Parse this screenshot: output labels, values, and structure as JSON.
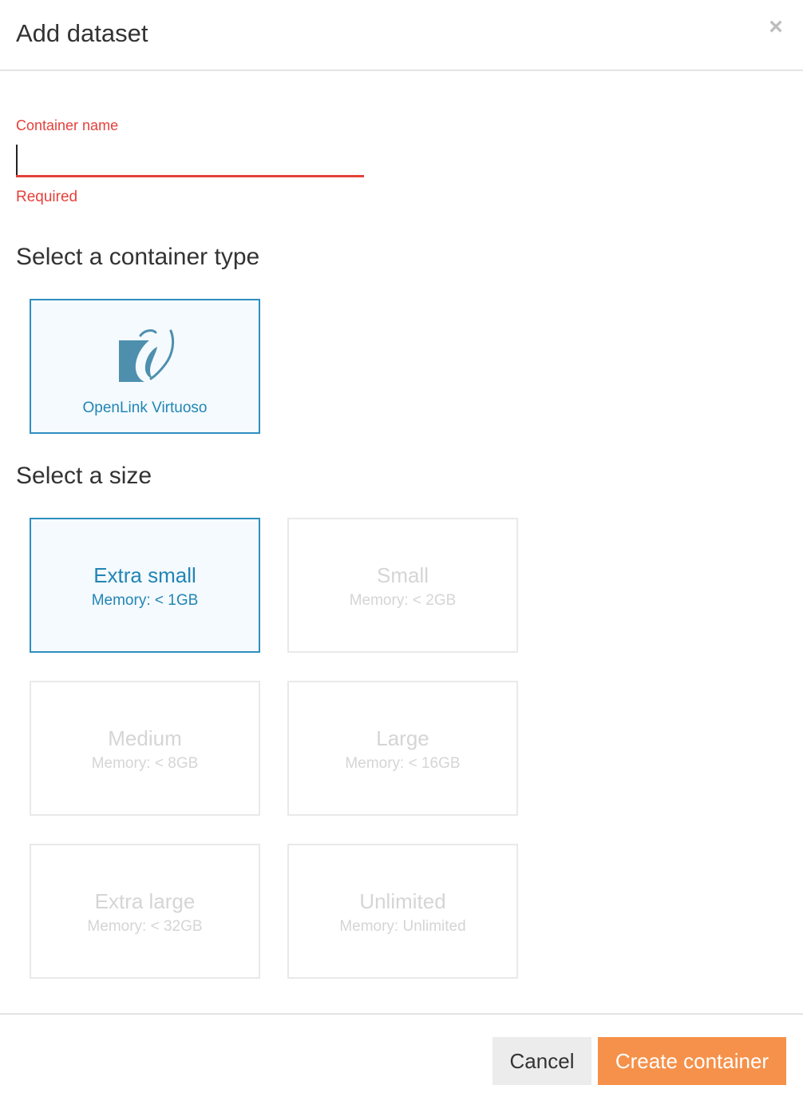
{
  "dialog": {
    "title": "Add dataset",
    "close_icon": "close-icon"
  },
  "form": {
    "container_name_label": "Container name",
    "container_name_value": "",
    "container_name_error": "Required"
  },
  "container_type": {
    "heading": "Select a container type",
    "options": [
      {
        "label": "OpenLink Virtuoso",
        "icon": "openlink-virtuoso-logo",
        "selected": true
      }
    ]
  },
  "size": {
    "heading": "Select a size",
    "options": [
      {
        "name": "Extra small",
        "memory": "Memory: < 1GB",
        "selected": true
      },
      {
        "name": "Small",
        "memory": "Memory: < 2GB",
        "selected": false
      },
      {
        "name": "Medium",
        "memory": "Memory: < 8GB",
        "selected": false
      },
      {
        "name": "Large",
        "memory": "Memory: < 16GB",
        "selected": false
      },
      {
        "name": "Extra large",
        "memory": "Memory: < 32GB",
        "selected": false
      },
      {
        "name": "Unlimited",
        "memory": "Memory: Unlimited",
        "selected": false
      }
    ]
  },
  "footer": {
    "cancel_label": "Cancel",
    "create_label": "Create container"
  },
  "colors": {
    "accent": "#2285b5",
    "error": "#e5413b",
    "primary_button": "#f5914a",
    "secondary_button": "#ececec"
  }
}
